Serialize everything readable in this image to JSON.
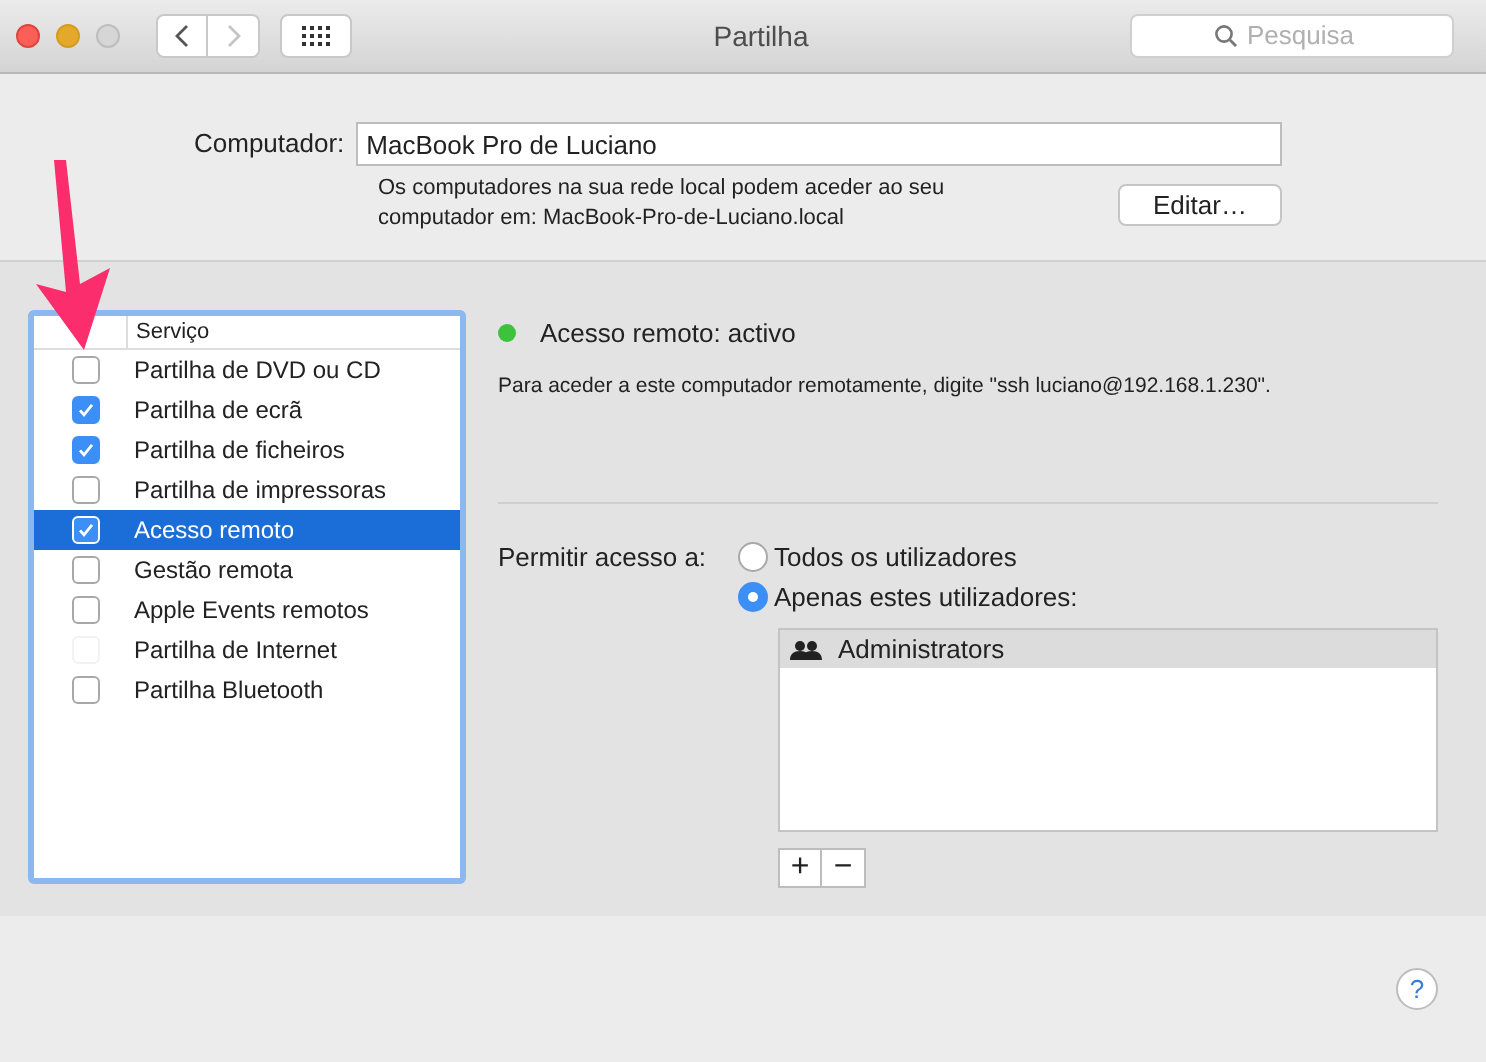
{
  "window": {
    "title": "Partilha"
  },
  "search": {
    "placeholder": "Pesquisa"
  },
  "computer": {
    "label": "Computador:",
    "value": "MacBook Pro de Luciano",
    "note": "Os computadores na sua rede local podem aceder ao seu computador em: MacBook-Pro-de-Luciano.local",
    "edit_button": "Editar…"
  },
  "services": {
    "column_2": "Serviço",
    "rows": [
      {
        "name": "Partilha de DVD ou CD",
        "checked": false,
        "selected": false,
        "disabled": false
      },
      {
        "name": "Partilha de ecrã",
        "checked": true,
        "selected": false,
        "disabled": false
      },
      {
        "name": "Partilha de ficheiros",
        "checked": true,
        "selected": false,
        "disabled": false
      },
      {
        "name": "Partilha de impressoras",
        "checked": false,
        "selected": false,
        "disabled": false
      },
      {
        "name": "Acesso remoto",
        "checked": true,
        "selected": true,
        "disabled": false
      },
      {
        "name": "Gestão remota",
        "checked": false,
        "selected": false,
        "disabled": false
      },
      {
        "name": "Apple Events remotos",
        "checked": false,
        "selected": false,
        "disabled": false
      },
      {
        "name": "Partilha de Internet",
        "checked": false,
        "selected": false,
        "disabled": true
      },
      {
        "name": "Partilha Bluetooth",
        "checked": false,
        "selected": false,
        "disabled": false
      }
    ]
  },
  "status": {
    "text": "Acesso remoto: activo",
    "color": "#3cc23c",
    "hint": "Para aceder a este computador remotamente, digite \"ssh luciano@192.168.1.230\"."
  },
  "access": {
    "label": "Permitir acesso a:",
    "options": [
      {
        "label": "Todos os utilizadores",
        "selected": false
      },
      {
        "label": "Apenas estes utilizadores:",
        "selected": true
      }
    ],
    "users": [
      {
        "name": "Administrators",
        "selected": true
      }
    ],
    "add": "+",
    "remove": "−"
  },
  "help": "?"
}
